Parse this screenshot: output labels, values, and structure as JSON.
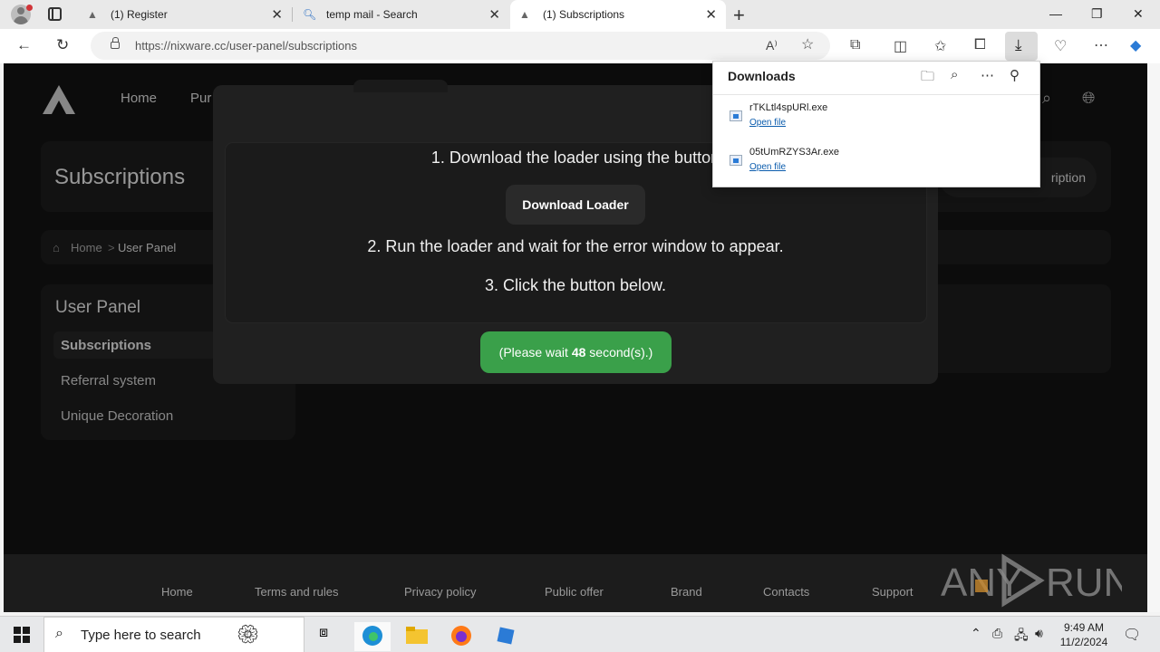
{
  "browser": {
    "tabs": [
      {
        "title": "(1) Register"
      },
      {
        "title": "temp mail - Search"
      },
      {
        "title": "(1) Subscriptions",
        "active": true
      }
    ],
    "url_host": "https://nixware.cc",
    "url_path": "/user-panel/subscriptions"
  },
  "downloads": {
    "title": "Downloads",
    "items": [
      {
        "name": "rTKLtl4spURl.exe",
        "action": "Open file"
      },
      {
        "name": "05tUmRZYS3Ar.exe",
        "action": "Open file"
      }
    ]
  },
  "site": {
    "nav": [
      "Home",
      "Pur"
    ],
    "subscriptions_title": "Subscriptions",
    "add_subscription": "ription",
    "breadcrumb": {
      "home": "Home",
      "sep": ">",
      "current": "User Panel"
    },
    "user_panel": {
      "title": "User Panel",
      "items": [
        "Subscriptions",
        "Referral system",
        "Unique Decoration"
      ]
    },
    "modal": {
      "step1": "1. Download the loader using the button",
      "download_button": "Download Loader",
      "step2": "2. Run the loader and wait for the error window to appear.",
      "step3": "3. Click the button below.",
      "wait_prefix": "(Please wait ",
      "wait_seconds": "48",
      "wait_suffix": " second(s).)"
    },
    "footer": [
      "Home",
      "Terms and rules",
      "Privacy policy",
      "Public offer",
      "Brand",
      "Contacts",
      "Support"
    ],
    "watermark": "ANY RUN"
  },
  "taskbar": {
    "search_placeholder": "Type here to search",
    "time": "9:49 AM",
    "date": "11/2/2024"
  },
  "colors": {
    "accent_green": "#3aa04a",
    "page_bg": "#131313",
    "card_bg": "#1c1c1c"
  }
}
